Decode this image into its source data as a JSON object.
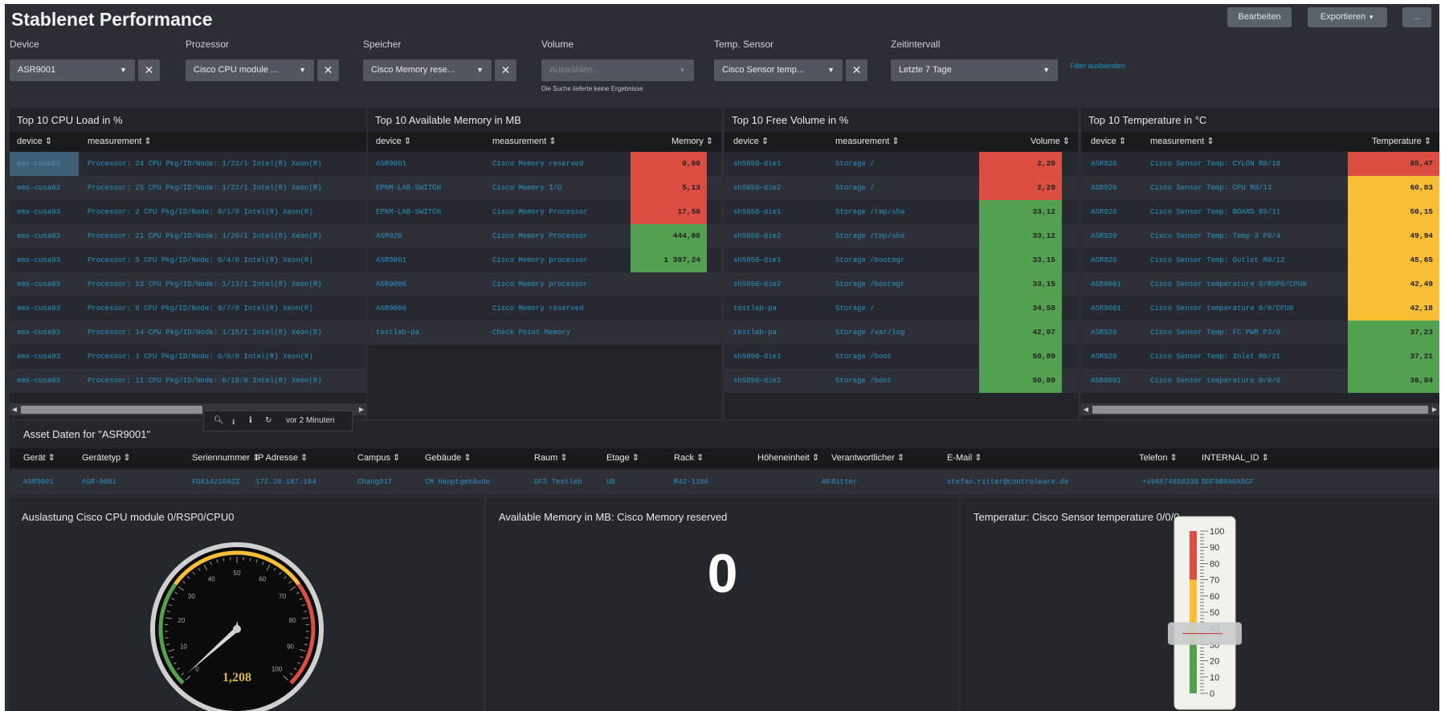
{
  "dashboard": {
    "title": "Stablenet Performance",
    "buttons": {
      "edit": "Bearbeiten",
      "export": "Exportieren",
      "more": "..."
    }
  },
  "filters": {
    "device": {
      "label": "Device",
      "value": "ASR9001"
    },
    "processor": {
      "label": "Prozessor",
      "value": "Cisco CPU module ..."
    },
    "memory": {
      "label": "Speicher",
      "value": "Cisco Memory rese..."
    },
    "volume": {
      "label": "Volume",
      "placeholder": "Auswählen...",
      "note": "Die Suche lieferte keine Ergebnisse"
    },
    "temp": {
      "label": "Temp. Sensor",
      "value": "Cisco Sensor temp..."
    },
    "time": {
      "label": "Zeitintervall",
      "value": "Letzte 7 Tage"
    },
    "hide_link": "Filter ausblenden"
  },
  "colors": {
    "red": "#dc4e41",
    "green": "#53a051",
    "yellow": "#f8be34",
    "link": "#2a92c4"
  },
  "cpu_table": {
    "title": "Top 10 CPU Load in %",
    "columns": [
      "device",
      "measurement"
    ],
    "rows": [
      [
        "ems-cusa03",
        "Processor: 24 CPU Pkg/ID/Node: 1/23/1 Intel(R) Xeon(R)"
      ],
      [
        "ems-cusa03",
        "Processor: 25 CPU Pkg/ID/Node: 1/22/1 Intel(R) Xeon(R)"
      ],
      [
        "ems-cusa03",
        "Processor: 2 CPU Pkg/ID/Node: 0/1/0 Intel(R) Xeon(R)"
      ],
      [
        "ems-cusa03",
        "Processor: 21 CPU Pkg/ID/Node: 1/20/1 Intel(R) Xeon(R)"
      ],
      [
        "ems-cusa03",
        "Processor: 5 CPU Pkg/ID/Node: 0/4/0 Intel(R) Xeon(R)"
      ],
      [
        "ems-cusa03",
        "Processor: 13 CPU Pkg/ID/Node: 1/13/1 Intel(R) Xeon(R)"
      ],
      [
        "ems-cusa03",
        "Processor: 8 CPU Pkg/ID/Node: 0/7/0 Intel(R) Xeon(R)"
      ],
      [
        "ems-cusa03",
        "Processor: 14 CPU Pkg/ID/Node: 1/15/1 Intel(R) Xeon(R)"
      ],
      [
        "ems-cusa03",
        "Processor: 1 CPU Pkg/ID/Node: 0/0/0 Intel(R) Xeon(R)"
      ],
      [
        "ems-cusa03",
        "Processor: 11 CPU Pkg/ID/Node: 0/10/0 Intel(R) Xeon(R)"
      ]
    ]
  },
  "mem_table": {
    "title": "Top 10 Available Memory in MB",
    "columns": [
      "device",
      "measurement",
      "Memory"
    ],
    "rows": [
      {
        "device": "ASR9001",
        "measurement": "Cisco Memory reserved",
        "value": "0,00",
        "color": "red"
      },
      {
        "device": "EPNM-LAB-SWITCH",
        "measurement": "Cisco Memory I/O",
        "value": "5,13",
        "color": "red"
      },
      {
        "device": "EPNM-LAB-SWITCH",
        "measurement": "Cisco Memory Processor",
        "value": "17,50",
        "color": "red"
      },
      {
        "device": "ASR920",
        "measurement": "Cisco Memory Processor",
        "value": "444,00",
        "color": "green"
      },
      {
        "device": "ASR9001",
        "measurement": "Cisco Memory processor",
        "value": "1 397,24",
        "color": "green"
      },
      {
        "device": "ASR9006",
        "measurement": "Cisco Memory processor",
        "value": "",
        "color": ""
      },
      {
        "device": "ASR9006",
        "measurement": "Cisco Memory reserved",
        "value": "",
        "color": ""
      },
      {
        "device": "testlab-pa",
        "measurement": "Check Point Memory",
        "value": "",
        "color": ""
      }
    ]
  },
  "vol_table": {
    "title": "Top 10 Free Volume in %",
    "columns": [
      "device",
      "measurement",
      "Volume"
    ],
    "rows": [
      {
        "device": "sh5050-die1",
        "measurement": "Storage /",
        "value": "2,29",
        "color": "red"
      },
      {
        "device": "sh5050-die2",
        "measurement": "Storage /",
        "value": "2,29",
        "color": "red"
      },
      {
        "device": "sh5050-die1",
        "measurement": "Storage /tmp/sha",
        "value": "33,12",
        "color": "green"
      },
      {
        "device": "sh5050-die2",
        "measurement": "Storage /tmp/sha",
        "value": "33,12",
        "color": "green"
      },
      {
        "device": "sh5050-die1",
        "measurement": "Storage /bootmgr",
        "value": "33,15",
        "color": "green"
      },
      {
        "device": "sh5050-die2",
        "measurement": "Storage /bootmgr",
        "value": "33,15",
        "color": "green"
      },
      {
        "device": "testlab-pa",
        "measurement": "Storage /",
        "value": "34,58",
        "color": "green"
      },
      {
        "device": "testlab-pa",
        "measurement": "Storage /var/log",
        "value": "42,07",
        "color": "green"
      },
      {
        "device": "sh5050-die1",
        "measurement": "Storage /boot",
        "value": "50,89",
        "color": "green"
      },
      {
        "device": "sh5050-die2",
        "measurement": "Storage /boot",
        "value": "50,89",
        "color": "green"
      }
    ]
  },
  "temp_table": {
    "title": "Top 10 Temperature in °C",
    "columns": [
      "device",
      "measurement",
      "Temperature"
    ],
    "rows": [
      {
        "device": "ASR920",
        "measurement": "Cisco Sensor Temp: CYLON R0/10",
        "value": "85,47",
        "color": "red"
      },
      {
        "device": "ASR920",
        "measurement": "Cisco Sensor Temp: CPU R0/13",
        "value": "60,83",
        "color": "yellow"
      },
      {
        "device": "ASR920",
        "measurement": "Cisco Sensor Temp: BOARD R0/11",
        "value": "50,15",
        "color": "yellow"
      },
      {
        "device": "ASR920",
        "measurement": "Cisco Sensor Temp: Temp 3 P0/4",
        "value": "49,94",
        "color": "yellow"
      },
      {
        "device": "ASR920",
        "measurement": "Cisco Sensor Temp: Outlet R0/12",
        "value": "45,65",
        "color": "yellow"
      },
      {
        "device": "ASR9001",
        "measurement": "Cisco Sensor temperature 0/RSP0/CPU0",
        "value": "42,49",
        "color": "yellow"
      },
      {
        "device": "ASR9001",
        "measurement": "Cisco Sensor temperature 0/0/CPU0",
        "value": "42,18",
        "color": "yellow"
      },
      {
        "device": "ASR920",
        "measurement": "Cisco Sensor Temp: FC PWR P3/0",
        "value": "37,23",
        "color": "green"
      },
      {
        "device": "ASR920",
        "measurement": "Cisco Sensor Temp: Inlet R0/21",
        "value": "37,21",
        "color": "green"
      },
      {
        "device": "ASR9001",
        "measurement": "Cisco Sensor temperature 0/0/0",
        "value": "36,84",
        "color": "green"
      }
    ]
  },
  "tooltip": {
    "refreshed": "vor 2 Minuten"
  },
  "asset": {
    "title": "Asset Daten for \"ASR9001\"",
    "columns": [
      "Gerät",
      "Gerätetyp",
      "Seriennummer",
      "IP Adresse",
      "Campus",
      "Gebäude",
      "Raum",
      "Etage",
      "Rack",
      "Höheneinheit",
      "Verantwortlicher",
      "E-Mail",
      "Telefon",
      "INTERNAL_ID"
    ],
    "row": [
      "ASR9001",
      "ASR-9001",
      "FOX1421G6ZZ",
      "172.20.187.194",
      "Chang017",
      "CM Hauptgebäude",
      "DFS Testlab",
      "U0",
      "R42-1106",
      "40",
      "Ritter",
      "stefan.ritter@controlware.de",
      "+496074858339",
      "DDF9B8A0A5CF"
    ]
  },
  "gauge": {
    "title": "Auslastung Cisco CPU module 0/RSP0/CPU0",
    "value": 1.208,
    "display": "1,208",
    "ticks": [
      "0",
      "10",
      "20",
      "30",
      "40",
      "50",
      "60",
      "70",
      "80",
      "90",
      "100"
    ]
  },
  "single_value": {
    "title": "Available Memory in MB: Cisco Memory reserved",
    "value": "0"
  },
  "thermo": {
    "title": "Temperatur: Cisco Sensor temperature 0/0/0",
    "value": 36.84,
    "ticks": [
      "100",
      "90",
      "80",
      "70",
      "60",
      "50",
      "40",
      "30",
      "20",
      "10",
      "0"
    ]
  }
}
